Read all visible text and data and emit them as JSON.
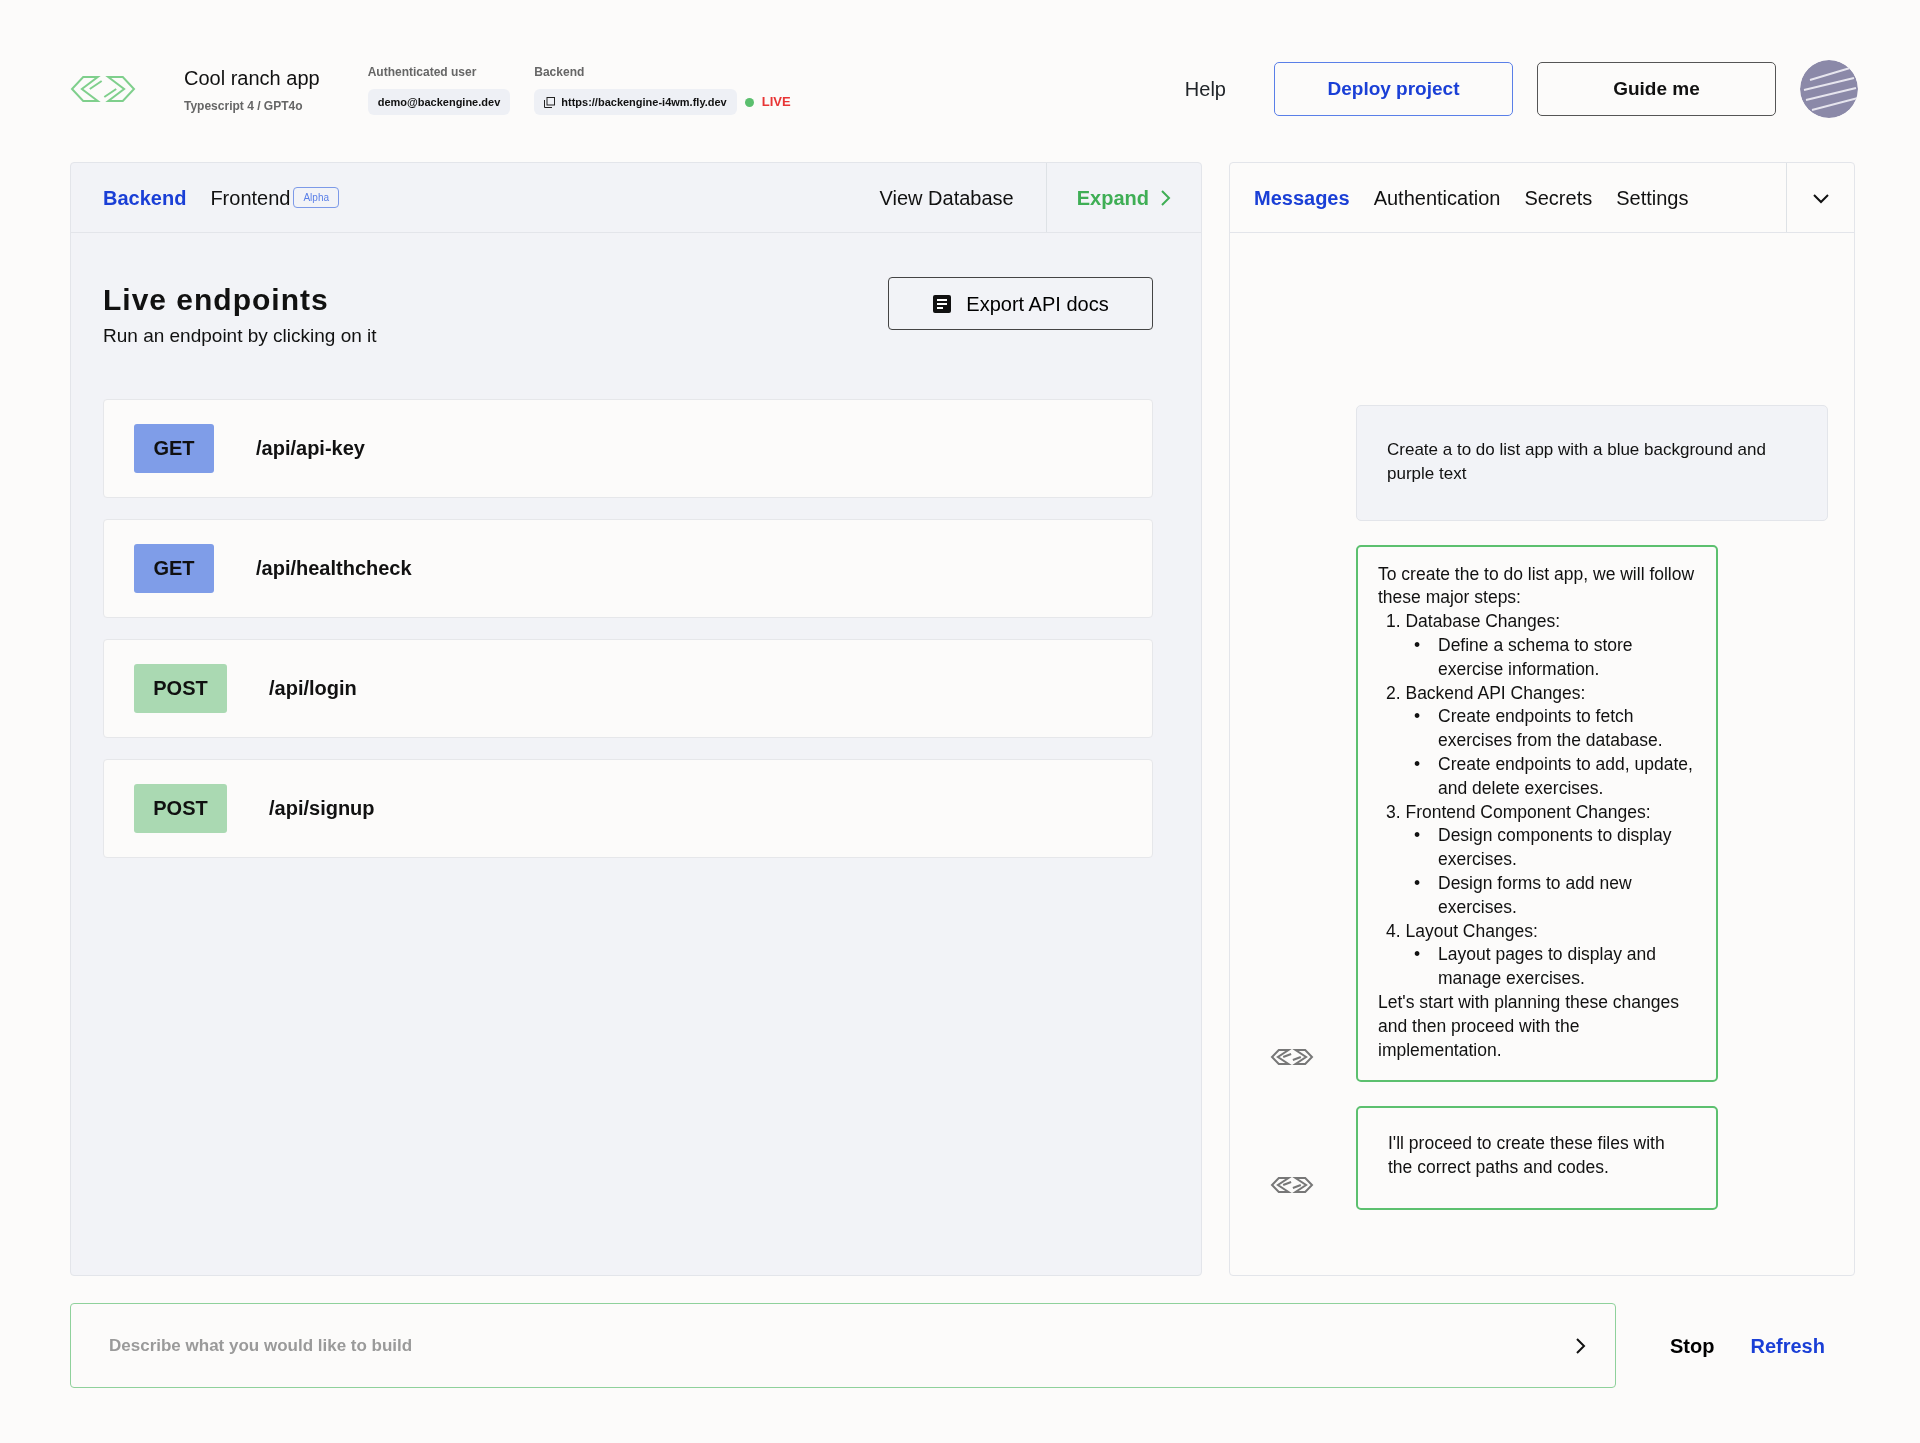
{
  "header": {
    "app_name": "Cool ranch app",
    "app_subtitle": "Typescript 4 / GPT4o",
    "user_label": "Authenticated user",
    "user_email": "demo@backengine.dev",
    "backend_label": "Backend",
    "backend_url": "https://backengine-i4wm.fly.dev",
    "status": "LIVE",
    "help": "Help",
    "deploy_button": "Deploy project",
    "guide_button": "Guide me"
  },
  "left_panel": {
    "tabs": [
      {
        "label": "Backend",
        "selected": true
      },
      {
        "label": "Frontend",
        "selected": false,
        "badge": "Alpha"
      }
    ],
    "view_database": "View Database",
    "expand": "Expand",
    "title": "Live endpoints",
    "subtitle": "Run an endpoint by clicking on it",
    "export_button": "Export API docs",
    "endpoints": [
      {
        "method": "GET",
        "path": "/api/api-key"
      },
      {
        "method": "GET",
        "path": "/api/healthcheck"
      },
      {
        "method": "POST",
        "path": "/api/login"
      },
      {
        "method": "POST",
        "path": "/api/signup"
      }
    ]
  },
  "right_panel": {
    "tabs": [
      {
        "label": "Messages",
        "selected": true
      },
      {
        "label": "Authentication",
        "selected": false
      },
      {
        "label": "Secrets",
        "selected": false
      },
      {
        "label": "Settings",
        "selected": false
      }
    ],
    "messages": [
      {
        "kind": "user",
        "text": "Create a to do list app with a blue background and purple text"
      },
      {
        "kind": "assistant",
        "intro": "To create the to do list app, we will follow these major steps:",
        "steps": [
          {
            "title": "1. Database Changes:",
            "children": [
              {
                "bullet": "•",
                "text": "Define a schema to store exercise information."
              }
            ]
          },
          {
            "title": "2. Backend API Changes:",
            "children": [
              {
                "bullet": "•",
                "text": "Create endpoints to fetch exercises from the database."
              },
              {
                "bullet": "•",
                "text": "Create endpoints to add, update, and delete exercises."
              }
            ]
          },
          {
            "title": "3. Frontend Component Changes:",
            "children": [
              {
                "bullet": "•",
                "text": "Design components to display exercises."
              },
              {
                "bullet": "•",
                "text": "Design forms to add new exercises."
              }
            ]
          },
          {
            "title": "4. Layout Changes:",
            "children": [
              {
                "bullet": "•",
                "text": "Layout pages to display and manage exercises."
              }
            ]
          }
        ],
        "outro": "Let's start with planning these changes and then proceed with the implementation."
      },
      {
        "kind": "assistant",
        "text": "I'll proceed to create these files with the correct paths and codes."
      }
    ]
  },
  "prompt": {
    "placeholder": "Describe what you would like to build",
    "stop": "Stop",
    "refresh": "Refresh"
  }
}
